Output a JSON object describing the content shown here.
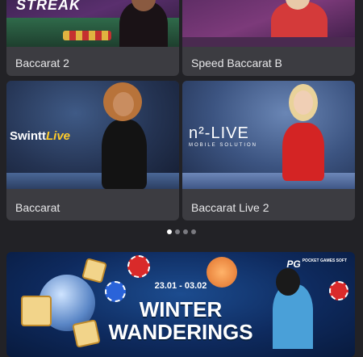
{
  "games": [
    {
      "label": "Baccarat 2",
      "banner_text": "STREAK"
    },
    {
      "label": "Speed Baccarat B"
    },
    {
      "label": "Baccarat",
      "provider": "SwinttLive",
      "provider_main": "Swintt",
      "provider_accent": "Live"
    },
    {
      "label": "Baccarat Live 2",
      "provider": "n²-LIVE",
      "provider_sub": "MOBILE SOLUTION"
    }
  ],
  "pagination": {
    "total": 4,
    "active": 0
  },
  "promo_banner": {
    "brand": "PG",
    "brand_sub": "POCKET GAMES SOFT",
    "date_range": "23.01 - 03.02",
    "title_line1": "WINTER",
    "title_line2": "WANDERINGS"
  },
  "colors": {
    "background": "#222226",
    "card": "#3c3c41",
    "active_dot": "#ffffff",
    "inactive_dot": "#7a7a80"
  }
}
